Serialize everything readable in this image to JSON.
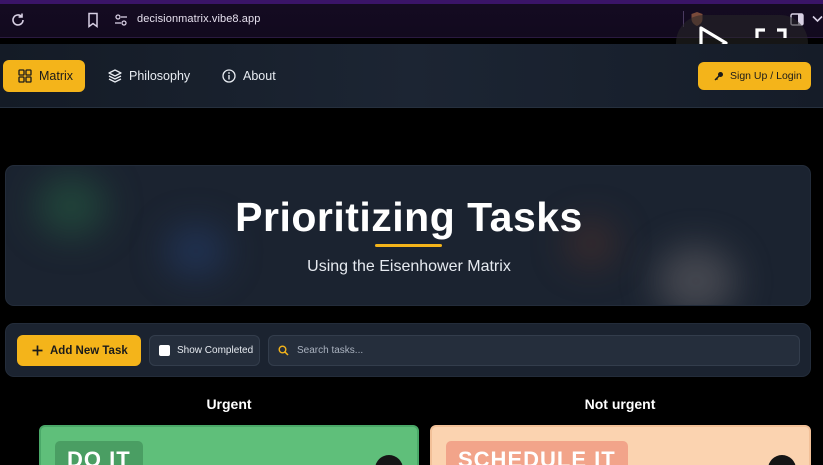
{
  "browser": {
    "url": "decisionmatrix.vibe8.app"
  },
  "nav": {
    "items": [
      {
        "label": "Matrix",
        "icon": "grid-icon"
      },
      {
        "label": "Philosophy",
        "icon": "layers-icon"
      },
      {
        "label": "About",
        "icon": "info-icon"
      }
    ],
    "signup_label": "Sign Up / Login"
  },
  "hero": {
    "title": "Prioritizing Tasks",
    "subtitle": "Using the Eisenhower Matrix"
  },
  "toolbar": {
    "add_task_label": "Add New Task",
    "show_completed_label": "Show Completed",
    "search_placeholder": "Search tasks..."
  },
  "matrix": {
    "columns": [
      "Urgent",
      "Not urgent"
    ],
    "quadrants": [
      {
        "label": "DO IT",
        "color": "#5fbf7a"
      },
      {
        "label": "SCHEDULE IT",
        "color": "#fbd3b0"
      }
    ]
  },
  "colors": {
    "accent": "#f4b41a",
    "panel": "#1b2330"
  }
}
